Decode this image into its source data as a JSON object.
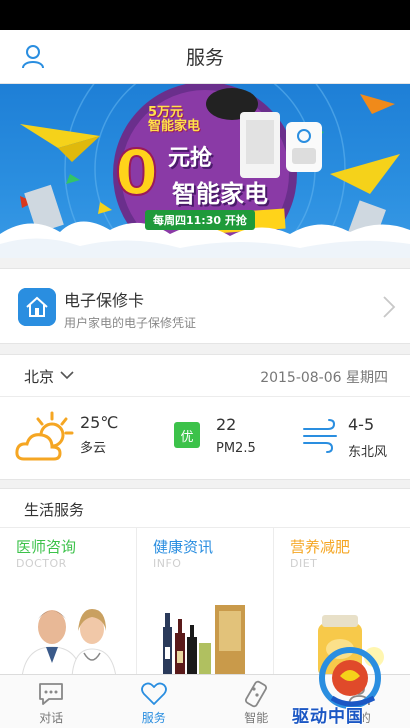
{
  "header": {
    "title": "服务",
    "user_icon": "user-icon"
  },
  "banner": {
    "promo_small_line1": "5万元",
    "promo_small_line2": "智能家电",
    "promo_big_number": "0",
    "promo_big_line1": "元抢",
    "promo_big_line2": "智能家电",
    "promo_badge": "每周四11:30 开抢"
  },
  "warranty": {
    "title": "电子保修卡",
    "subtitle": "用户家电的电子保修凭证",
    "icon": "house-icon"
  },
  "weather": {
    "city": "北京",
    "date": "2015-08-06 星期四",
    "temperature": "25℃",
    "condition": "多云",
    "aqi_badge": "优",
    "aqi_value": "22",
    "aqi_label": "PM2.5",
    "wind_level": "4-5",
    "wind_direction": "东北风"
  },
  "life": {
    "title": "生活服务",
    "cards": [
      {
        "title": "医师咨询",
        "subtitle": "DOCTOR",
        "color": "#3cc24a"
      },
      {
        "title": "健康资讯",
        "subtitle": "INFO",
        "color": "#2a8ee0"
      },
      {
        "title": "营养减肥",
        "subtitle": "DIET",
        "color": "#f5a623"
      }
    ]
  },
  "tabs": [
    {
      "label": "对话",
      "icon": "chat-icon",
      "active": false
    },
    {
      "label": "服务",
      "icon": "heart-icon",
      "active": true
    },
    {
      "label": "智能",
      "icon": "remote-icon",
      "active": false
    },
    {
      "label": "我的",
      "icon": "profile-icon",
      "active": false
    }
  ],
  "watermark": {
    "text": "驱动中国"
  },
  "colors": {
    "accent": "#2a8ee0",
    "green": "#3cc24a",
    "orange": "#f5a623"
  }
}
